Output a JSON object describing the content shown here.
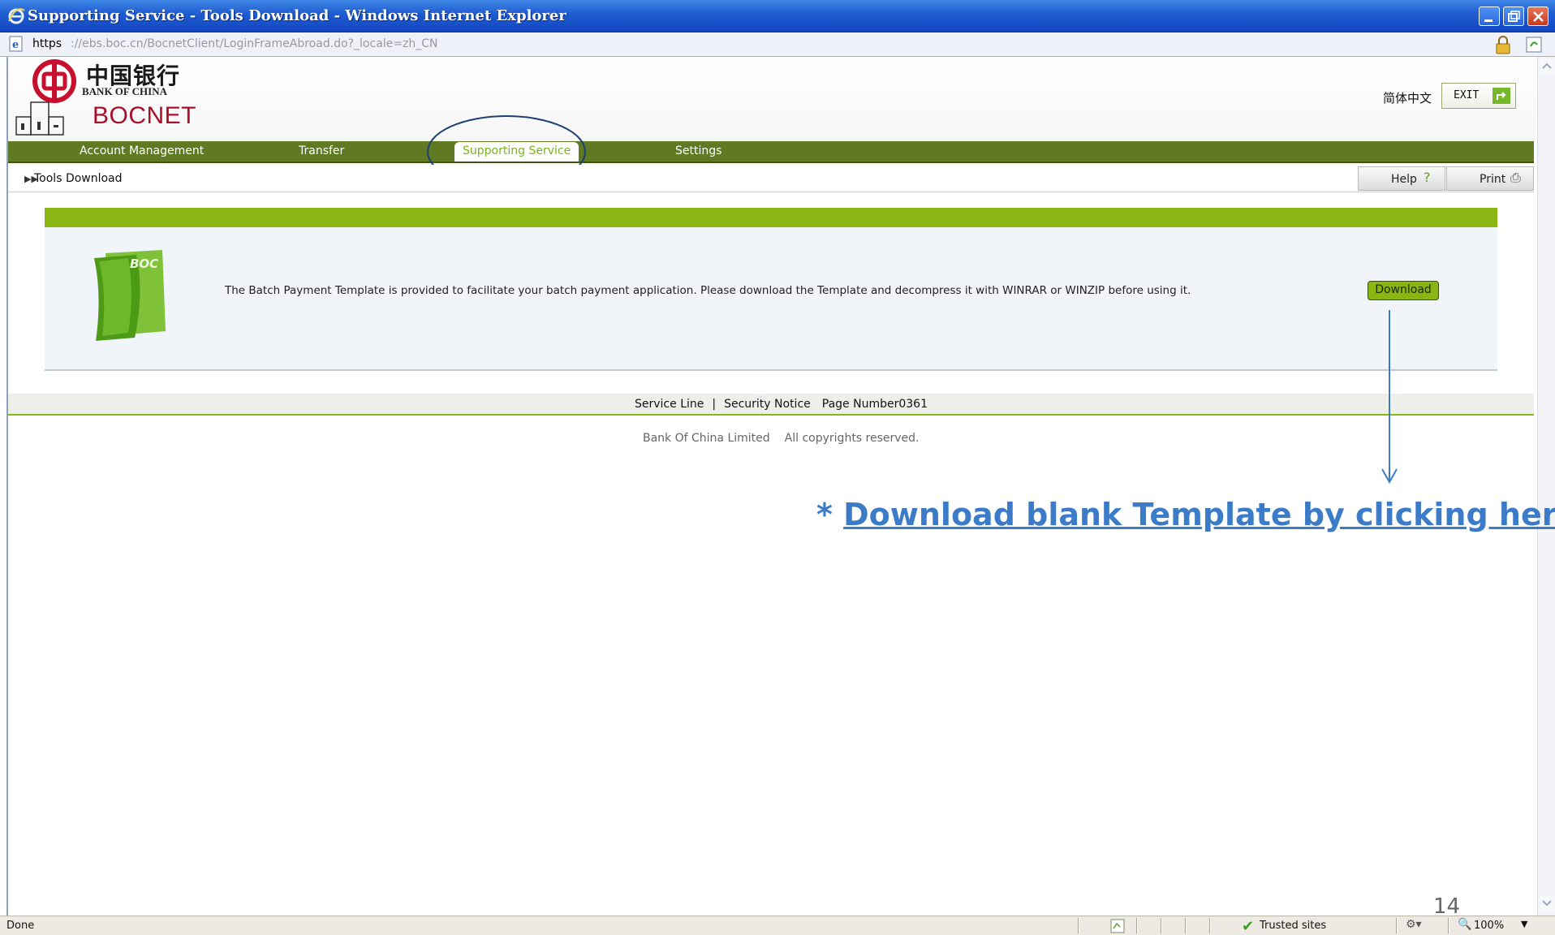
{
  "window": {
    "title": "Supporting Service - Tools Download - Windows Internet Explorer",
    "url_scheme": "https",
    "url_rest": "://ebs.boc.cn/BocnetClient/LoginFrameAbroad.do?_locale=zh_CN"
  },
  "header": {
    "logo_cn": "中国银行",
    "logo_en": "BANK OF CHINA",
    "brand": "BOCNET",
    "lang_link": "简体中文",
    "exit_label": "EXIT"
  },
  "nav": {
    "items": [
      "Account Management",
      "Transfer",
      "Supporting Service",
      "Settings"
    ],
    "active": "Supporting Service"
  },
  "breadcrumb": {
    "current": "Tools Download"
  },
  "toolbar": {
    "help_label": "Help",
    "print_label": "Print"
  },
  "content": {
    "icon_label": "BOC",
    "description": "The Batch Payment Template is provided to facilitate your batch payment application. Please download the Template and decompress it with WINRAR or WINZIP before using it.",
    "download_label": "Download"
  },
  "footer": {
    "service_line": "Service Line",
    "separator": "|",
    "security_notice": "Security Notice",
    "page_number": "Page Number0361",
    "company": "Bank Of China Limited",
    "rights": "All copyrights reserved."
  },
  "annotation": {
    "asterisk": "*",
    "text": "Download blank Template by clicking here."
  },
  "slide_page_number": "14",
  "statusbar": {
    "status": "Done",
    "zone": "Trusted sites",
    "zoom": "100%"
  },
  "colors": {
    "nav_green": "#5f7a23",
    "accent_green": "#8ab614",
    "brand_red": "#a8102a",
    "annotation_blue": "#3b7bc8"
  }
}
